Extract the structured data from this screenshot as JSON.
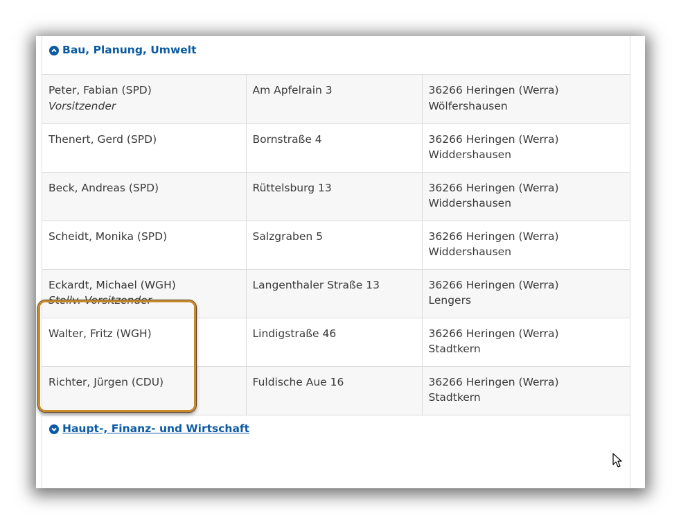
{
  "sections": {
    "open": {
      "title": "Bau, Planung, Umwelt",
      "icon": "chevron-up-circle-icon"
    },
    "next": {
      "title": "Haupt-, Finanz- und Wirtschaft",
      "icon": "chevron-down-circle-icon"
    }
  },
  "members": [
    {
      "name": "Peter, Fabian (SPD)",
      "role": "Vorsitzender",
      "street": "Am Apfelrain 3",
      "city": "36266 Heringen (Werra)",
      "district": "Wölfershausen"
    },
    {
      "name": "Thenert, Gerd (SPD)",
      "role": "",
      "street": "Bornstraße 4",
      "city": "36266 Heringen (Werra)",
      "district": "Widdershausen"
    },
    {
      "name": "Beck, Andreas (SPD)",
      "role": "",
      "street": "Rüttelsburg 13",
      "city": "36266 Heringen (Werra)",
      "district": "Widdershausen"
    },
    {
      "name": "Scheidt, Monika (SPD)",
      "role": "",
      "street": "Salzgraben 5",
      "city": "36266 Heringen (Werra)",
      "district": "Widdershausen"
    },
    {
      "name": "Eckardt, Michael (WGH)",
      "role": "Stellv. Vorsitzender",
      "street": "Langenthaler Straße 13",
      "city": "36266 Heringen (Werra)",
      "district": "Lengers"
    },
    {
      "name": "Walter, Fritz (WGH)",
      "role": "",
      "street": "Lindigstraße 46",
      "city": "36266 Heringen (Werra)",
      "district": "Stadtkern"
    },
    {
      "name": "Richter, Jürgen (CDU)",
      "role": "",
      "street": "Fuldische Aue 16",
      "city": "36266 Heringen (Werra)",
      "district": "Stadtkern"
    }
  ],
  "colors": {
    "link": "#0b5aa3",
    "highlight": "#c98a2c",
    "row_alt": "#f7f7f7"
  }
}
